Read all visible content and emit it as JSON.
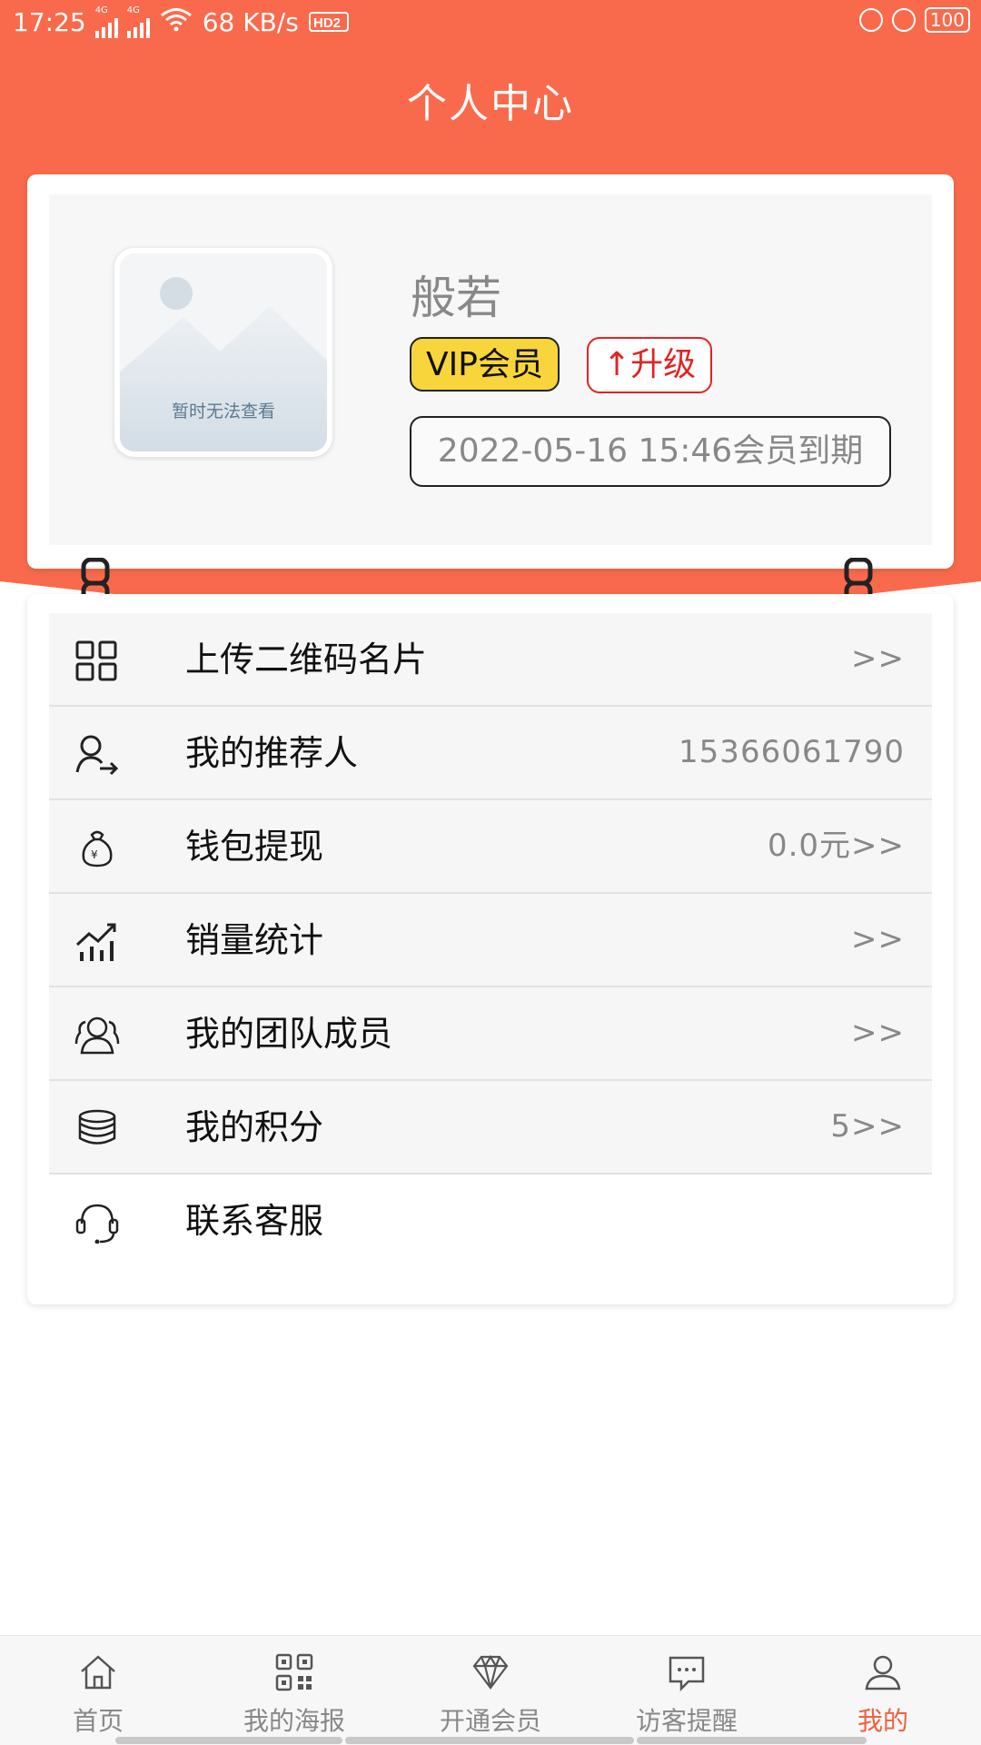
{
  "status_bar": {
    "time": "17:25",
    "network_speed": "68 KB/s",
    "battery": "100",
    "signal_label": "4G"
  },
  "header": {
    "title": "个人中心"
  },
  "profile": {
    "avatar_placeholder_text": "暂时无法查看",
    "name": "般若",
    "vip_badge": "VIP会员",
    "upgrade_label": "↑升级",
    "expiry_text": "2022-05-16 15:46会员到期"
  },
  "menu": {
    "items": [
      {
        "label": "上传二维码名片",
        "value": ">>",
        "icon": "qr-card-icon"
      },
      {
        "label": "我的推荐人",
        "value": "15366061790",
        "icon": "referrer-icon"
      },
      {
        "label": "钱包提现",
        "value": "0.0元>>",
        "icon": "money-bag-icon"
      },
      {
        "label": "销量统计",
        "value": ">>",
        "icon": "sales-chart-icon"
      },
      {
        "label": "我的团队成员",
        "value": ">>",
        "icon": "team-icon"
      },
      {
        "label": "我的积分",
        "value": "5>>",
        "icon": "coins-icon"
      },
      {
        "label": "联系客服",
        "value": "",
        "icon": "headset-icon"
      }
    ]
  },
  "bottom_nav": {
    "items": [
      {
        "label": "首页",
        "icon": "home-icon",
        "active": false
      },
      {
        "label": "我的海报",
        "icon": "qr-poster-icon",
        "active": false
      },
      {
        "label": "开通会员",
        "icon": "diamond-icon",
        "active": false
      },
      {
        "label": "访客提醒",
        "icon": "message-icon",
        "active": false
      },
      {
        "label": "我的",
        "icon": "user-icon",
        "active": true
      }
    ]
  },
  "colors": {
    "header_bg": "#f96a4c",
    "vip_badge_bg": "#f8d53b",
    "upgrade_red": "#e02424",
    "nav_active": "#f0603f"
  }
}
